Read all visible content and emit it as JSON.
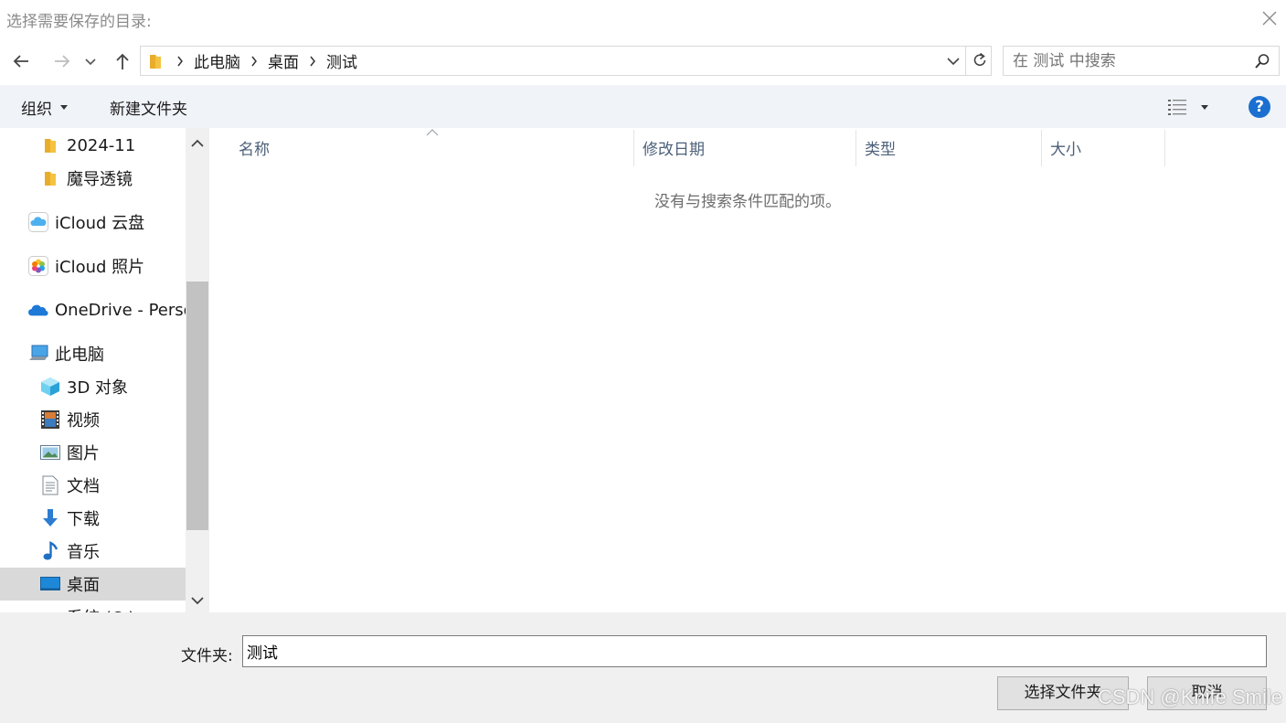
{
  "dialog": {
    "title": "选择需要保存的目录:"
  },
  "navigation": {
    "back_icon": "arrow-left-icon",
    "forward_icon": "arrow-right-icon",
    "recent_icon": "chevron-down-icon",
    "up_icon": "arrow-up-icon",
    "breadcrumbs": [
      "此电脑",
      "桌面",
      "测试"
    ],
    "search_placeholder": "在 测试 中搜索"
  },
  "commands": {
    "organize": "组织",
    "new_folder": "新建文件夹",
    "help": "?"
  },
  "sidebar": {
    "items": [
      {
        "label": "2024-11",
        "icon": "folder-icon"
      },
      {
        "label": "魔导透镜",
        "icon": "folder-icon"
      },
      {
        "label": "iCloud 云盘",
        "icon": "icloud-drive-icon"
      },
      {
        "label": "iCloud 照片",
        "icon": "icloud-photos-icon"
      },
      {
        "label": "OneDrive - Perso",
        "icon": "onedrive-icon"
      },
      {
        "label": "此电脑",
        "icon": "this-pc-icon"
      },
      {
        "label": "3D 对象",
        "icon": "3d-objects-icon"
      },
      {
        "label": "视频",
        "icon": "videos-icon"
      },
      {
        "label": "图片",
        "icon": "pictures-icon"
      },
      {
        "label": "文档",
        "icon": "documents-icon"
      },
      {
        "label": "下载",
        "icon": "downloads-icon"
      },
      {
        "label": "音乐",
        "icon": "music-icon"
      },
      {
        "label": "桌面",
        "icon": "desktop-icon",
        "selected": true
      },
      {
        "label": "系统 (C:)",
        "icon": "drive-icon"
      }
    ]
  },
  "file_list": {
    "columns": [
      "名称",
      "修改日期",
      "类型",
      "大小"
    ],
    "empty_message": "没有与搜索条件匹配的项。"
  },
  "footer": {
    "folder_label": "文件夹:",
    "folder_value": "测试",
    "select_button": "选择文件夹",
    "cancel_button": "取消"
  },
  "watermark": "CSDN @Knife Smile",
  "colors": {
    "accent": "#1a6fd0",
    "command_bar_bg": "#f0f3f8",
    "selected_bg": "#d9d9d9",
    "footer_bg": "#f0f0f0",
    "column_header_text": "#4c607a"
  }
}
